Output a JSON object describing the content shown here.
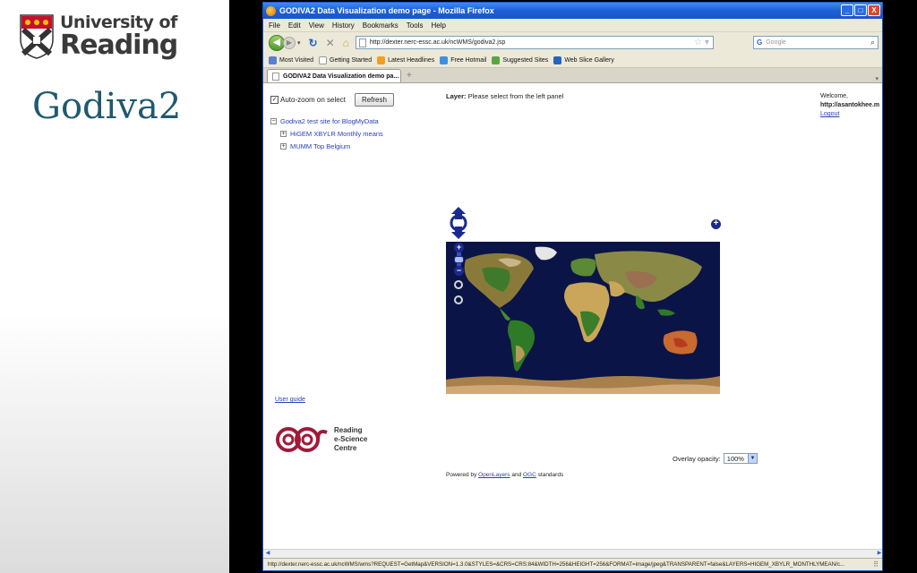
{
  "slide": {
    "logo_line1": "University of",
    "logo_line2": "Reading",
    "title": "Godiva2"
  },
  "window": {
    "title": "GODIVA2 Data Visualization demo page - Mozilla Firefox",
    "buttons": {
      "minimize": "_",
      "maximize": "□",
      "close": "X"
    }
  },
  "menubar": [
    "File",
    "Edit",
    "View",
    "History",
    "Bookmarks",
    "Tools",
    "Help"
  ],
  "navbar": {
    "url": "http://dexter.nerc-essc.ac.uk/ncWMS/godiva2.jsp",
    "search_engine": "G",
    "search_placeholder": "Google"
  },
  "bookmarks": [
    {
      "label": "Most Visited",
      "color": "#5a7fd1"
    },
    {
      "label": "Getting Started",
      "color": "#ffffff"
    },
    {
      "label": "Latest Headlines",
      "color": "#f0a020"
    },
    {
      "label": "Free Hotmail",
      "color": "#3d8fe0"
    },
    {
      "label": "Suggested Sites",
      "color": "#5aa542"
    },
    {
      "label": "Web Slice Gallery",
      "color": "#2a62c4"
    }
  ],
  "tab": {
    "label": "GODIVA2 Data Visualization demo pa...",
    "new_tab": "+"
  },
  "page": {
    "autozoom_label": "Auto-zoom on select",
    "autozoom_checked": "✓",
    "refresh_label": "Refresh",
    "tree": {
      "root": {
        "toggle": "−",
        "label": "Godiva2 test site for BlogMyData"
      },
      "children": [
        {
          "toggle": "+",
          "label": "HiGEM XBYLR Monthly means"
        },
        {
          "toggle": "+",
          "label": "MUMM Top Belgium"
        }
      ]
    },
    "layer_label": "Layer:",
    "layer_value": " Please select from the left panel",
    "welcome": "Welcome,",
    "welcome_user": "http://asantokhee.m",
    "logout": "Logout",
    "user_guide": "User guide",
    "resc_logo": [
      "Reading",
      "e-Science",
      "Centre"
    ],
    "overlay_label": "Overlay opacity:",
    "overlay_value": "100%",
    "powered_prefix": "Powered by ",
    "powered_link1": "OpenLayers",
    "powered_mid": " and ",
    "powered_link2": "OGC",
    "powered_suffix": " standards"
  },
  "status": {
    "text": "http://dexter.nerc-essc.ac.uk/ncWMS/wms?REQUEST=GetMap&VERSION=1.3.0&STYLES=&CRS=CRS:84&WIDTH=256&HEIGHT=256&FORMAT=image/jpeg&TRANSPARENT=false&LAYERS=HIGEM_XBYLR_MONTHLYMEAN/c..."
  }
}
